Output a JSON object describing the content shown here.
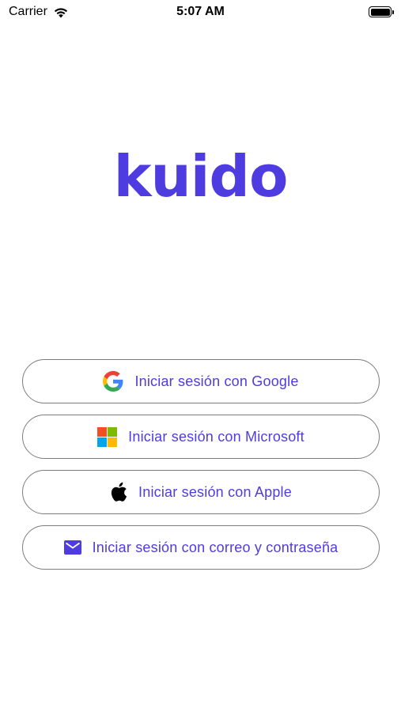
{
  "status_bar": {
    "carrier": "Carrier",
    "time": "5:07 AM"
  },
  "app": {
    "logo_text": "kuido",
    "brand_color": "#4F3CE0"
  },
  "buttons": {
    "google": {
      "label": "Iniciar sesión con Google",
      "icon": "google-icon"
    },
    "microsoft": {
      "label": "Iniciar sesión con Microsoft",
      "icon": "microsoft-icon"
    },
    "apple": {
      "label": "Iniciar sesión con Apple",
      "icon": "apple-icon"
    },
    "email": {
      "label": "Iniciar sesión con correo y contraseña",
      "icon": "mail-icon"
    }
  }
}
